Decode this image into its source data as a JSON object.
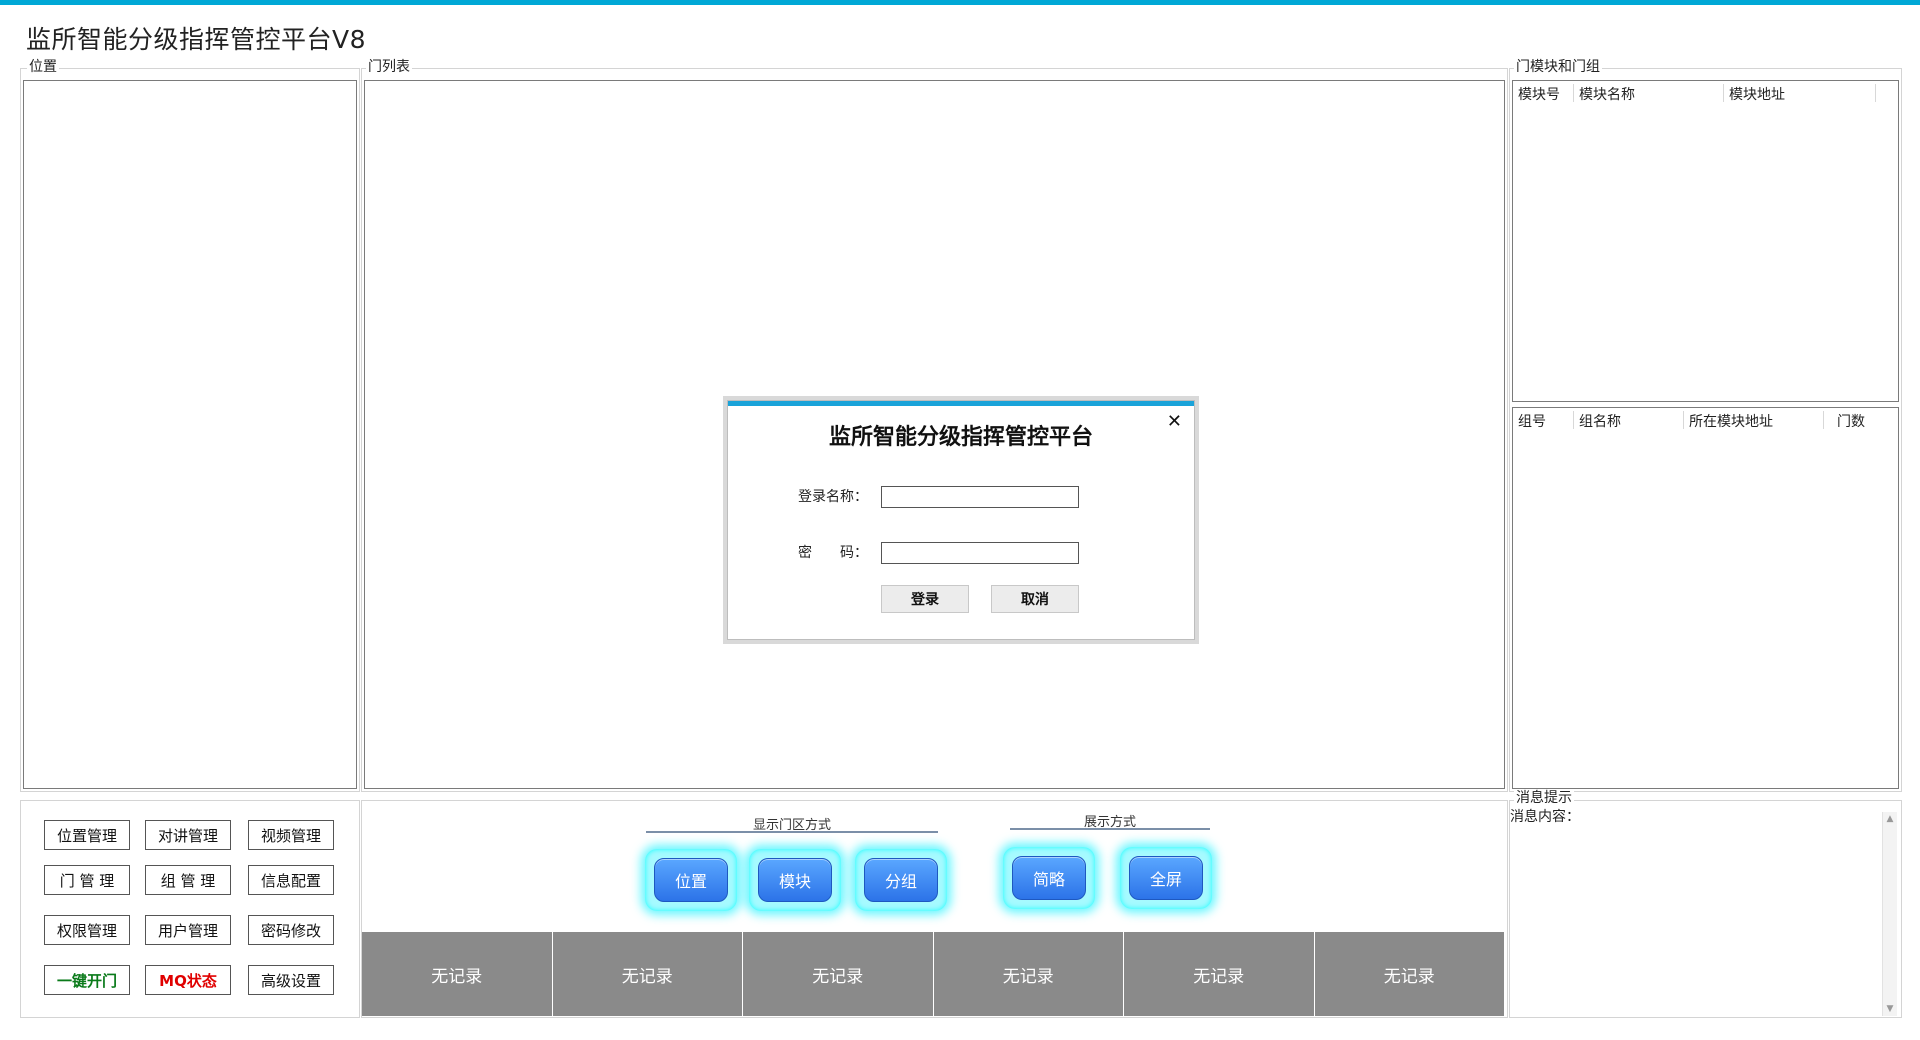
{
  "app": {
    "title": "监所智能分级指挥管控平台V8"
  },
  "panels": {
    "location": {
      "label": "位置"
    },
    "door_list": {
      "label": "门列表"
    },
    "modules_groups": {
      "label": "门模块和门组"
    },
    "message": {
      "label": "消息提示",
      "content_label": "消息内容："
    }
  },
  "module_table": {
    "columns": [
      "模块号",
      "模块名称",
      "模块地址"
    ]
  },
  "group_table": {
    "columns": [
      "组号",
      "组名称",
      "所在模块地址",
      "门数"
    ]
  },
  "manage_buttons": [
    [
      "位置管理",
      "对讲管理",
      "视频管理"
    ],
    [
      "门 管 理",
      "组 管 理",
      "信息配置"
    ],
    [
      "权限管理",
      "用户管理",
      "密码修改"
    ],
    [
      "一键开门",
      "MQ状态",
      "高级设置"
    ]
  ],
  "display_area": {
    "title": "显示门区方式",
    "buttons": [
      "位置",
      "模块",
      "分组"
    ]
  },
  "show_mode": {
    "title": "展示方式",
    "buttons": [
      "简略",
      "全屏"
    ]
  },
  "records": [
    "无记录",
    "无记录",
    "无记录",
    "无记录",
    "无记录",
    "无记录"
  ],
  "colors": {
    "accent": "#00a8d6",
    "glow": "#00f0ff",
    "button_blue": "#2c73e8",
    "strip_gray": "#8a8a8a"
  },
  "login_dialog": {
    "title": "监所智能分级指挥管控平台",
    "username_label": "登录名称：",
    "password_label": "密　　码：",
    "username_value": "",
    "password_value": "",
    "login_label": "登录",
    "cancel_label": "取消",
    "close_icon": "close-icon"
  }
}
